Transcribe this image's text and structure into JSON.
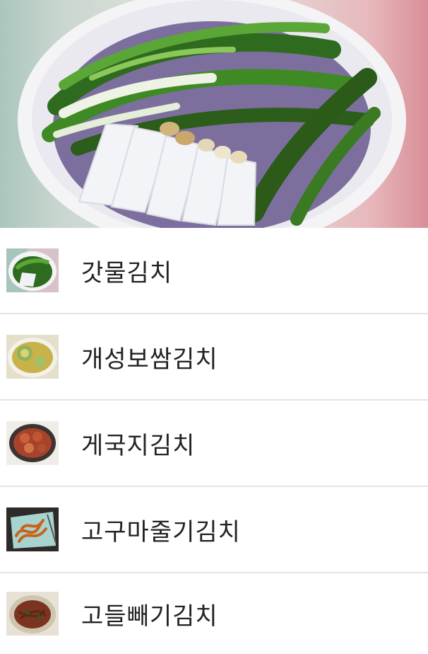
{
  "hero": {
    "icon": "dolsan-gat-kimchi-photo"
  },
  "kimchi_list": [
    {
      "label": "갓물김치",
      "thumb": "green-kimchi-bowl"
    },
    {
      "label": "개성보쌈김치",
      "thumb": "wrapped-kimchi-plate"
    },
    {
      "label": "게국지김치",
      "thumb": "crab-kimchi-dish"
    },
    {
      "label": "고구마줄기김치",
      "thumb": "sweet-potato-stem-kimchi"
    },
    {
      "label": "고들빼기김치",
      "thumb": "godeulbbaegi-kimchi"
    }
  ],
  "colors": {
    "text": "#222222",
    "divider": "#e3e3e3",
    "background": "#ffffff"
  }
}
